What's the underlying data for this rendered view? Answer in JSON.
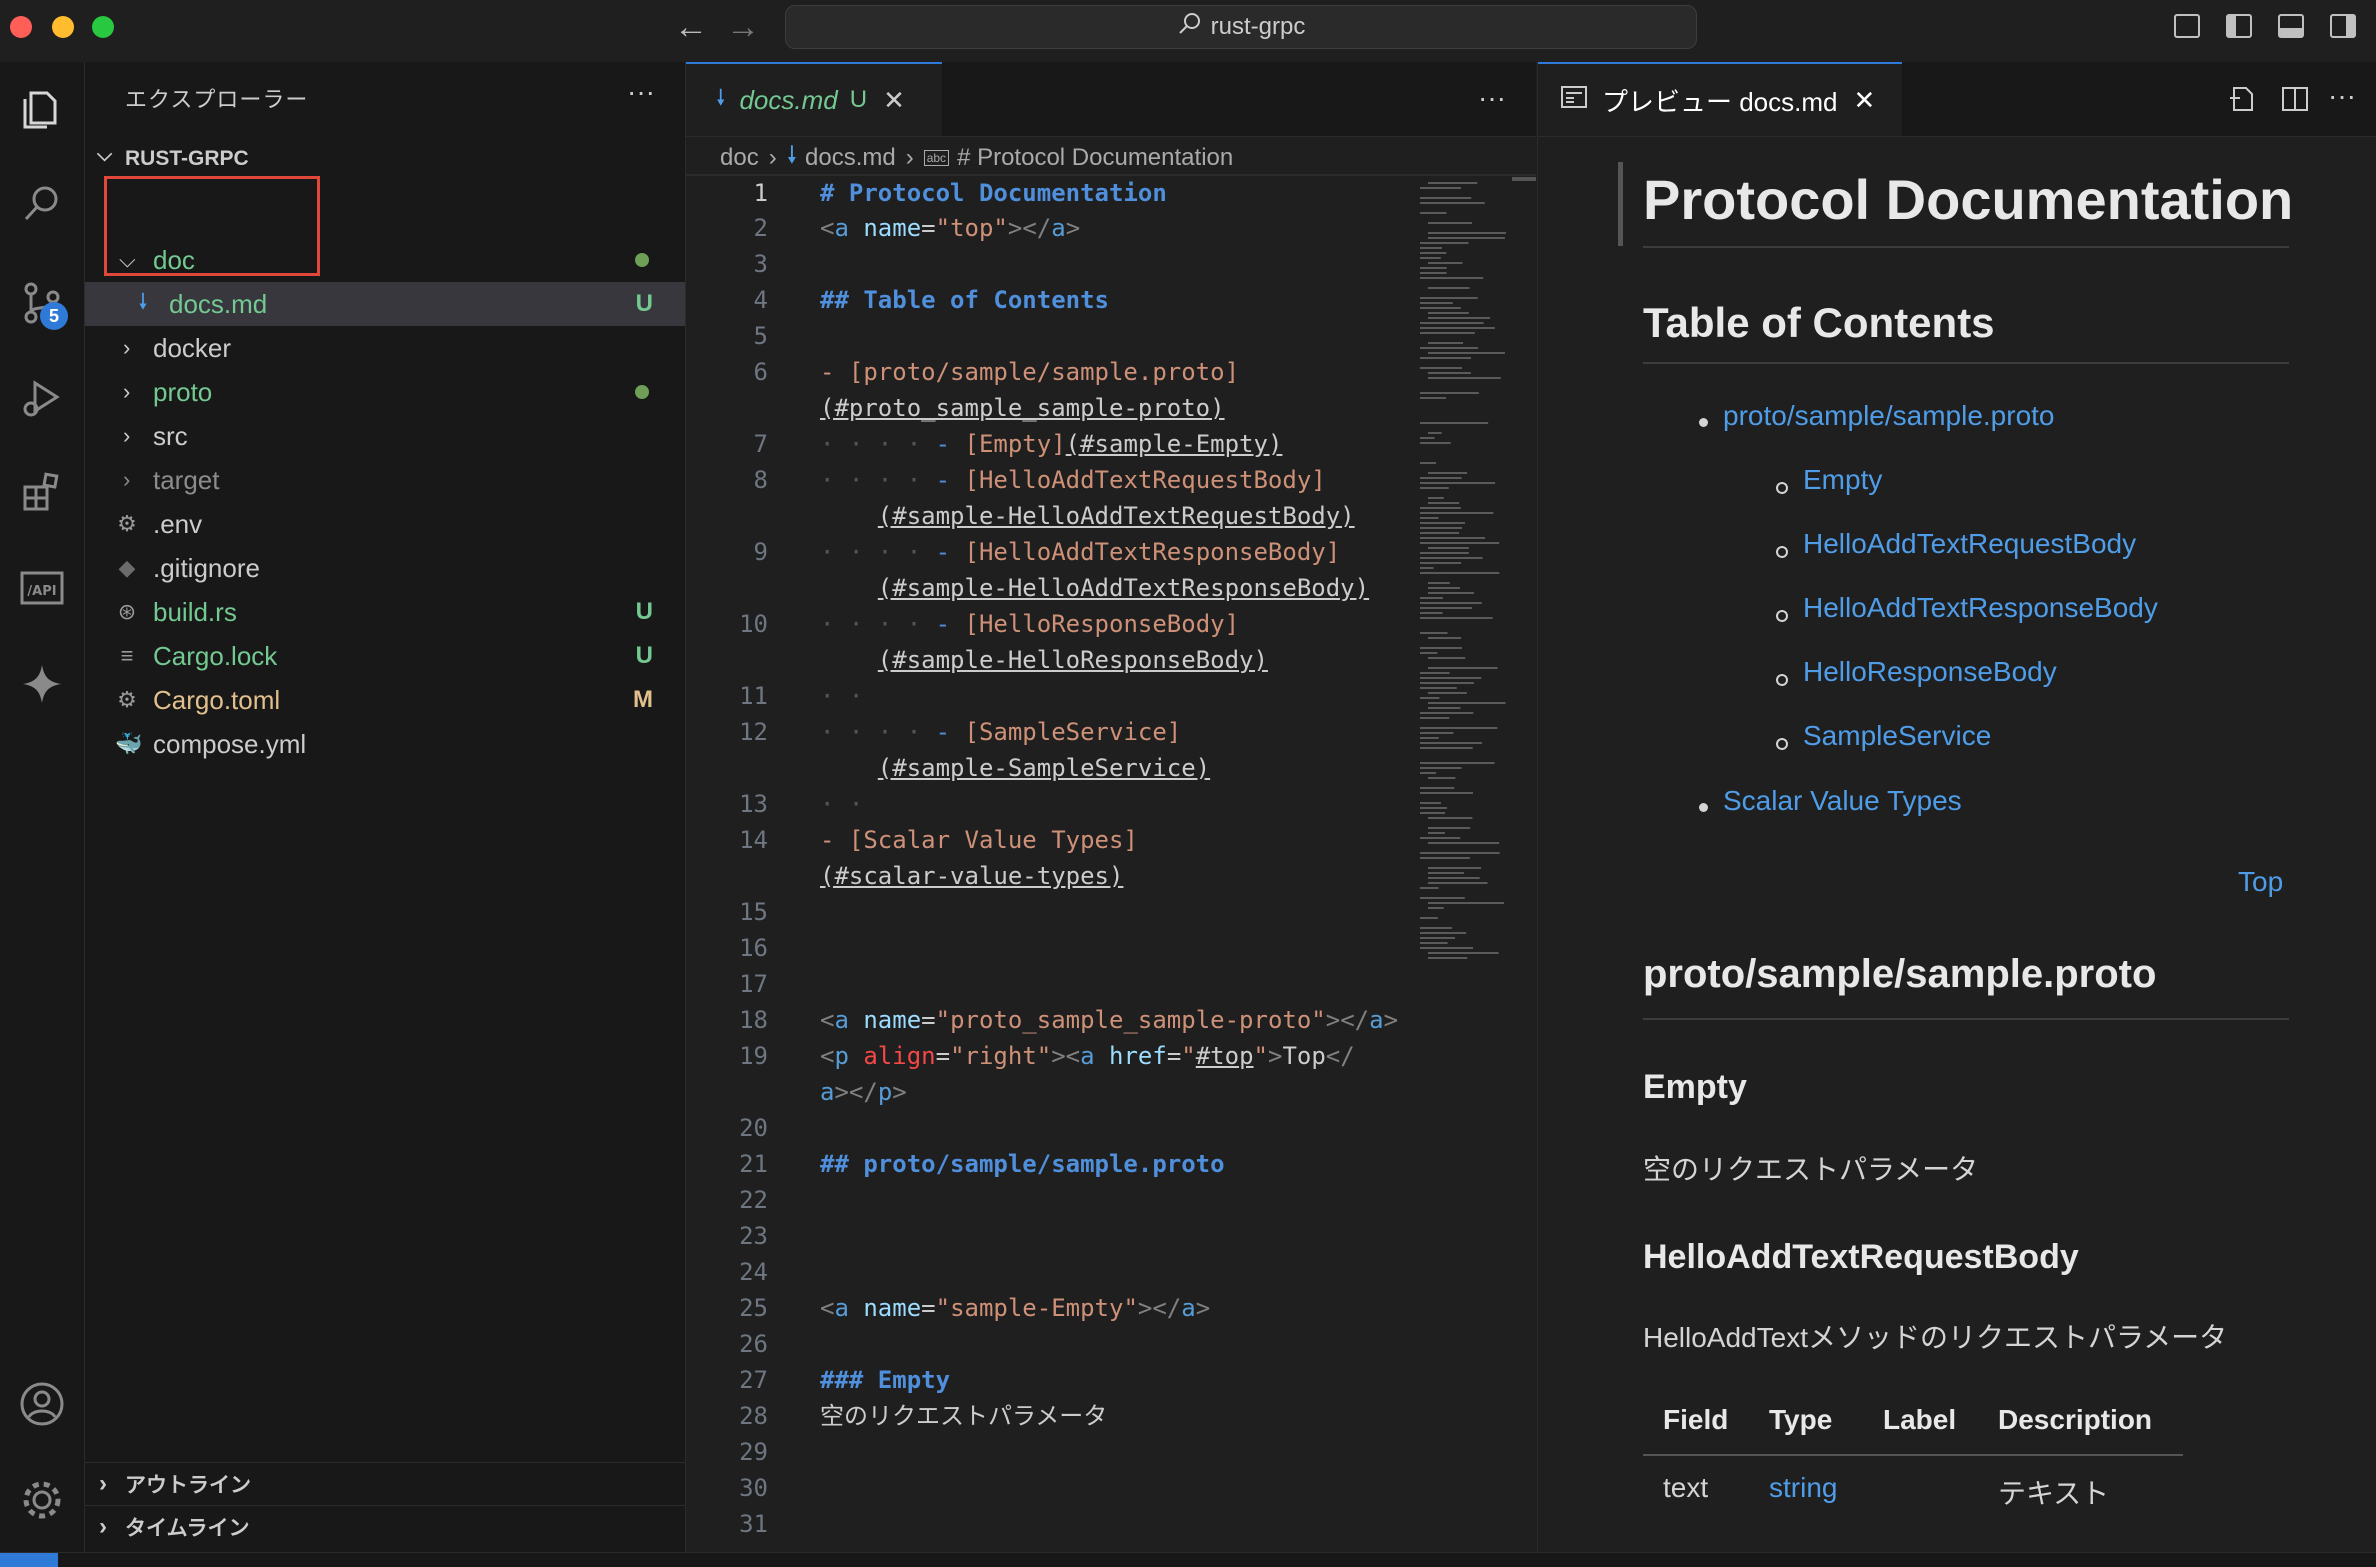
{
  "window": {
    "title": "rust-grpc"
  },
  "sidebar": {
    "title": "エクスプローラー",
    "more": "···",
    "project": "RUST-GRPC",
    "tree": [
      {
        "name": "doc",
        "kind": "folder-open",
        "color": "#73c991",
        "status": "dot"
      },
      {
        "name": "docs.md",
        "kind": "markdown",
        "color": "#73c991",
        "status": "U",
        "selected": true
      },
      {
        "name": "docker",
        "kind": "folder",
        "color": "#cccccc",
        "status": ""
      },
      {
        "name": "proto",
        "kind": "folder",
        "color": "#73c991",
        "status": "dot"
      },
      {
        "name": "src",
        "kind": "folder",
        "color": "#cccccc",
        "status": ""
      },
      {
        "name": "target",
        "kind": "folder",
        "color": "#8c8c8c",
        "status": ""
      },
      {
        "name": ".env",
        "kind": "gear",
        "color": "#cccccc",
        "status": ""
      },
      {
        "name": ".gitignore",
        "kind": "git",
        "color": "#cccccc",
        "status": ""
      },
      {
        "name": "build.rs",
        "kind": "rust",
        "color": "#73c991",
        "status": "U"
      },
      {
        "name": "Cargo.lock",
        "kind": "lines",
        "color": "#73c991",
        "status": "U"
      },
      {
        "name": "Cargo.toml",
        "kind": "gear",
        "color": "#e2c08d",
        "status": "M"
      },
      {
        "name": "compose.yml",
        "kind": "docker",
        "color": "#cccccc",
        "status": ""
      }
    ],
    "panels": {
      "outline": "アウトライン",
      "timeline": "タイムライン"
    }
  },
  "activity": {
    "scm_badge": "5"
  },
  "editor": {
    "tab": {
      "label": "docs.md",
      "status": "U"
    },
    "more": "···",
    "breadcrumb": {
      "folder": "doc",
      "file": "docs.md",
      "symbol": "# Protocol Documentation"
    },
    "line_numbers": [
      "1",
      "2",
      "3",
      "4",
      "5",
      "6",
      "7",
      "8",
      "9",
      "10",
      "11",
      "12",
      "13",
      "14",
      "15",
      "16",
      "17",
      "18",
      "19",
      "20",
      "21",
      "22",
      "23",
      "24",
      "25",
      "26",
      "27",
      "28",
      "29",
      "30",
      "31"
    ],
    "code": {
      "l1": "# Protocol Documentation",
      "l4": "## Table of Contents",
      "l6a": "- [proto/sample/sample.proto]",
      "l6b": "(#proto_sample_sample-proto)",
      "l7a": "[Empty]",
      "l7b": "(#sample-Empty)",
      "l8a": "[HelloAddTextRequestBody]",
      "l8b": "(#sample-HelloAddTextRequestBody)",
      "l9a": "[HelloAddTextResponseBody]",
      "l9b": "(#sample-HelloAddTextResponseBody)",
      "l10a": "[HelloResponseBody]",
      "l10b": "(#sample-HelloResponseBody)",
      "l12a": "[SampleService]",
      "l12b": "(#sample-SampleService)",
      "l14a": "- [Scalar Value Types]",
      "l14b": "(#scalar-value-types)",
      "l21": "## proto/sample/sample.proto",
      "l27": "### Empty",
      "l28": "空のリクエストパラメータ",
      "name_top": "top",
      "name_proto": "proto_sample_sample-proto",
      "align_right": "right",
      "href_top": "#top",
      "top_text": "Top",
      "name_empty": "sample-Empty"
    }
  },
  "preview": {
    "tab": {
      "label": "プレビュー docs.md"
    },
    "h1": "Protocol Documentation",
    "toc_heading": "Table of Contents",
    "toc": {
      "proto": "proto/sample/sample.proto",
      "items": [
        "Empty",
        "HelloAddTextRequestBody",
        "HelloAddTextResponseBody",
        "HelloResponseBody",
        "SampleService"
      ],
      "scalar": "Scalar Value Types"
    },
    "top_link": "Top",
    "section_h2": "proto/sample/sample.proto",
    "empty_h3": "Empty",
    "empty_desc": "空のリクエストパラメータ",
    "req_h3": "HelloAddTextRequestBody",
    "req_desc": "HelloAddTextメソッドのリクエストパラメータ",
    "table": {
      "headers": [
        "Field",
        "Type",
        "Label",
        "Description"
      ],
      "row": [
        "text",
        "string",
        "",
        "テキスト"
      ]
    }
  },
  "colors": {
    "accent": "#2f7ad6",
    "added": "#73c991",
    "modified": "#e2c08d",
    "link": "#4f9de8"
  }
}
